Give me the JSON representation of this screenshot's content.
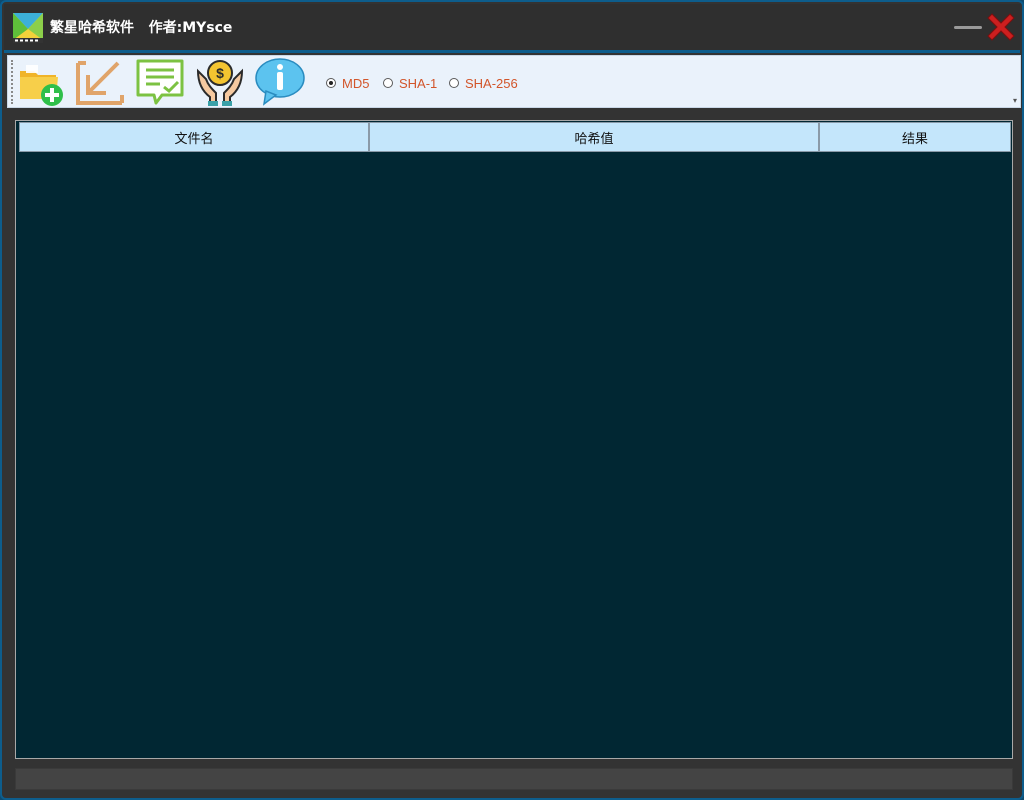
{
  "window": {
    "title": "繁星哈希软件   作者:MYsce"
  },
  "toolbar": {
    "buttons": [
      {
        "name": "add-file",
        "icon": "folder-add-icon"
      },
      {
        "name": "import",
        "icon": "arrow-down-left-icon"
      },
      {
        "name": "verify",
        "icon": "document-check-icon"
      },
      {
        "name": "donate",
        "icon": "hands-coin-icon"
      },
      {
        "name": "about",
        "icon": "info-bubble-icon"
      }
    ],
    "hash_options": [
      {
        "label": "MD5",
        "checked": true
      },
      {
        "label": "SHA-1",
        "checked": false
      },
      {
        "label": "SHA-256",
        "checked": false
      }
    ]
  },
  "table": {
    "columns": [
      "文件名",
      "哈希值",
      "结果"
    ],
    "rows": []
  },
  "colors": {
    "titlebar": "#2f2f2f",
    "accent_border": "#0d5d8c",
    "table_background": "#012733",
    "header_background": "#c4e6fb",
    "radio_label": "#d2552a",
    "close_red": "#cc1f1f"
  }
}
